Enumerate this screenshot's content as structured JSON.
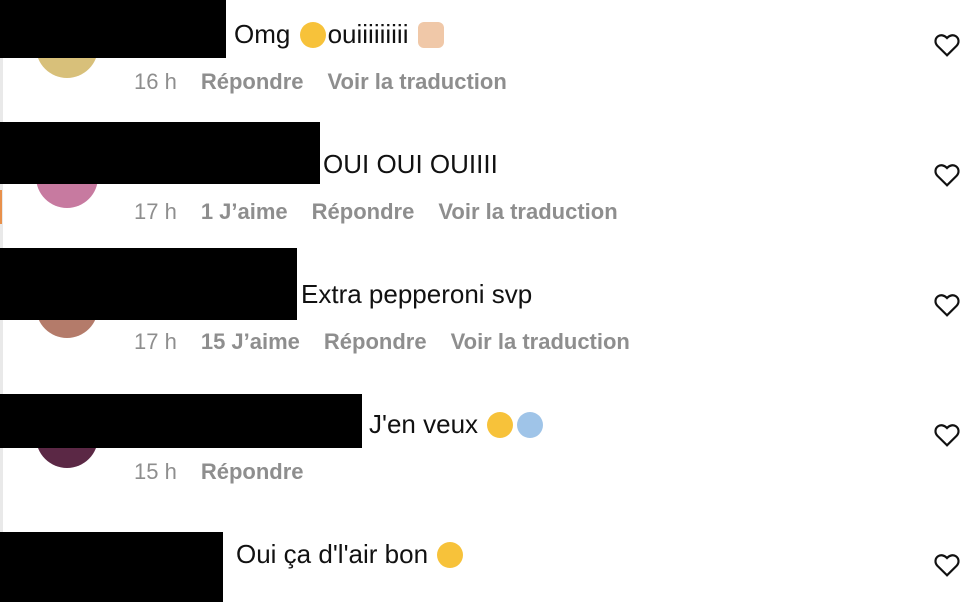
{
  "comments": [
    {
      "text": "Omg",
      "text_after": "ouiiiiiiiii",
      "emoji_after_1": "yum-face-emoji",
      "emoji_after_2": "folded-hands-emoji",
      "time": "16 h",
      "likes": "",
      "reply": "Répondre",
      "translate": "Voir la traduction"
    },
    {
      "text": "OUI OUI OUIIII",
      "time": "17 h",
      "likes": "1 J’aime",
      "reply": "Répondre",
      "translate": "Voir la traduction"
    },
    {
      "text": "Extra pepperoni svp",
      "time": "17 h",
      "likes": "15 J’aime",
      "reply": "Répondre",
      "translate": "Voir la traduction"
    },
    {
      "text": "J'en veux",
      "time": "15 h",
      "likes": "",
      "reply": "Répondre",
      "translate": "",
      "emojis": [
        "heart-eyes-emoji",
        "screaming-face-emoji"
      ]
    },
    {
      "text": "Oui ça d'l'air bon",
      "emojis": [
        "smiling-face-with-hearts-emoji"
      ]
    }
  ],
  "colors": {
    "meta": "#8e8e8e",
    "text": "#111111",
    "redaction": "#000000"
  },
  "icons": {
    "like": "heart-outline-icon"
  }
}
